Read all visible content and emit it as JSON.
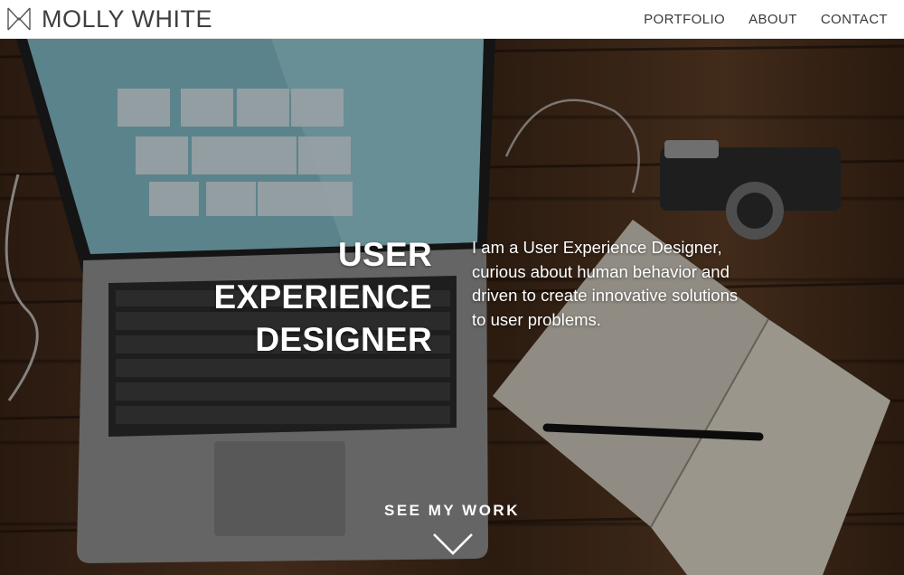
{
  "header": {
    "brand_name": "MOLLY WHITE",
    "logo_icon": "mw-monogram-icon",
    "nav": [
      {
        "label": "PORTFOLIO"
      },
      {
        "label": "ABOUT"
      },
      {
        "label": "CONTACT"
      }
    ]
  },
  "hero": {
    "headline_lines": [
      "USER",
      "EXPERIENCE",
      "DESIGNER"
    ],
    "intro": "I am a User Experience Designer, curious about human behavior and driven to create innovative solutions to user problems.",
    "cta_label": "SEE MY WORK",
    "cta_icon": "chevron-down-icon"
  },
  "colors": {
    "header_bg": "#ffffff",
    "header_text": "#3f3f3f",
    "hero_text": "#ffffff",
    "wood": "#5a3a24"
  }
}
